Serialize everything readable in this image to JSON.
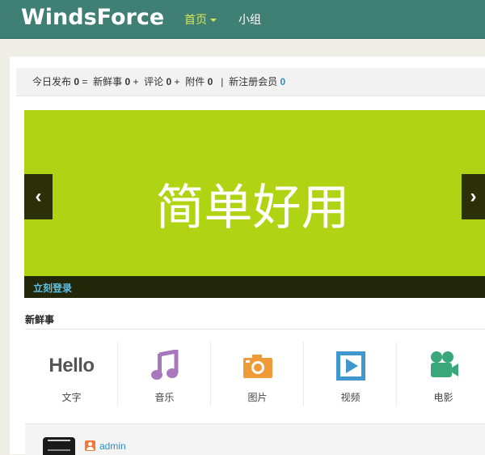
{
  "header": {
    "brand": "WindsForce",
    "nav": {
      "home": "首页",
      "group": "小组"
    },
    "colors": {
      "bar": "#3f7f74",
      "active_nav": "#d9e85a"
    }
  },
  "stats": {
    "today_label": "今日发布",
    "today_count": "0",
    "eq": "=",
    "fresh_label": "新鲜事",
    "fresh_count": "0",
    "plus": "+",
    "comment_label": "评论",
    "comment_count": "0",
    "attach_label": "附件",
    "attach_count": "0",
    "divider": "|",
    "new_member_label": "新注册会员",
    "new_member_count": "0"
  },
  "banner": {
    "title": "简单好用",
    "prev": "‹",
    "next": "›",
    "login_link": "立刻登录",
    "bg_color": "#b0d414"
  },
  "fresh": {
    "title": "新鲜事",
    "types": [
      {
        "icon": "hello-text-icon",
        "icon_text": "Hello",
        "label": "文字",
        "color": "#555555"
      },
      {
        "icon": "music-note-icon",
        "label": "音乐",
        "color": "#a877bd"
      },
      {
        "icon": "camera-icon",
        "label": "图片",
        "color": "#ee9a37"
      },
      {
        "icon": "play-video-icon",
        "label": "视频",
        "color": "#3f97cf"
      },
      {
        "icon": "movie-camera-icon",
        "label": "电影",
        "color": "#39a779"
      }
    ]
  },
  "post": {
    "username": "admin"
  }
}
